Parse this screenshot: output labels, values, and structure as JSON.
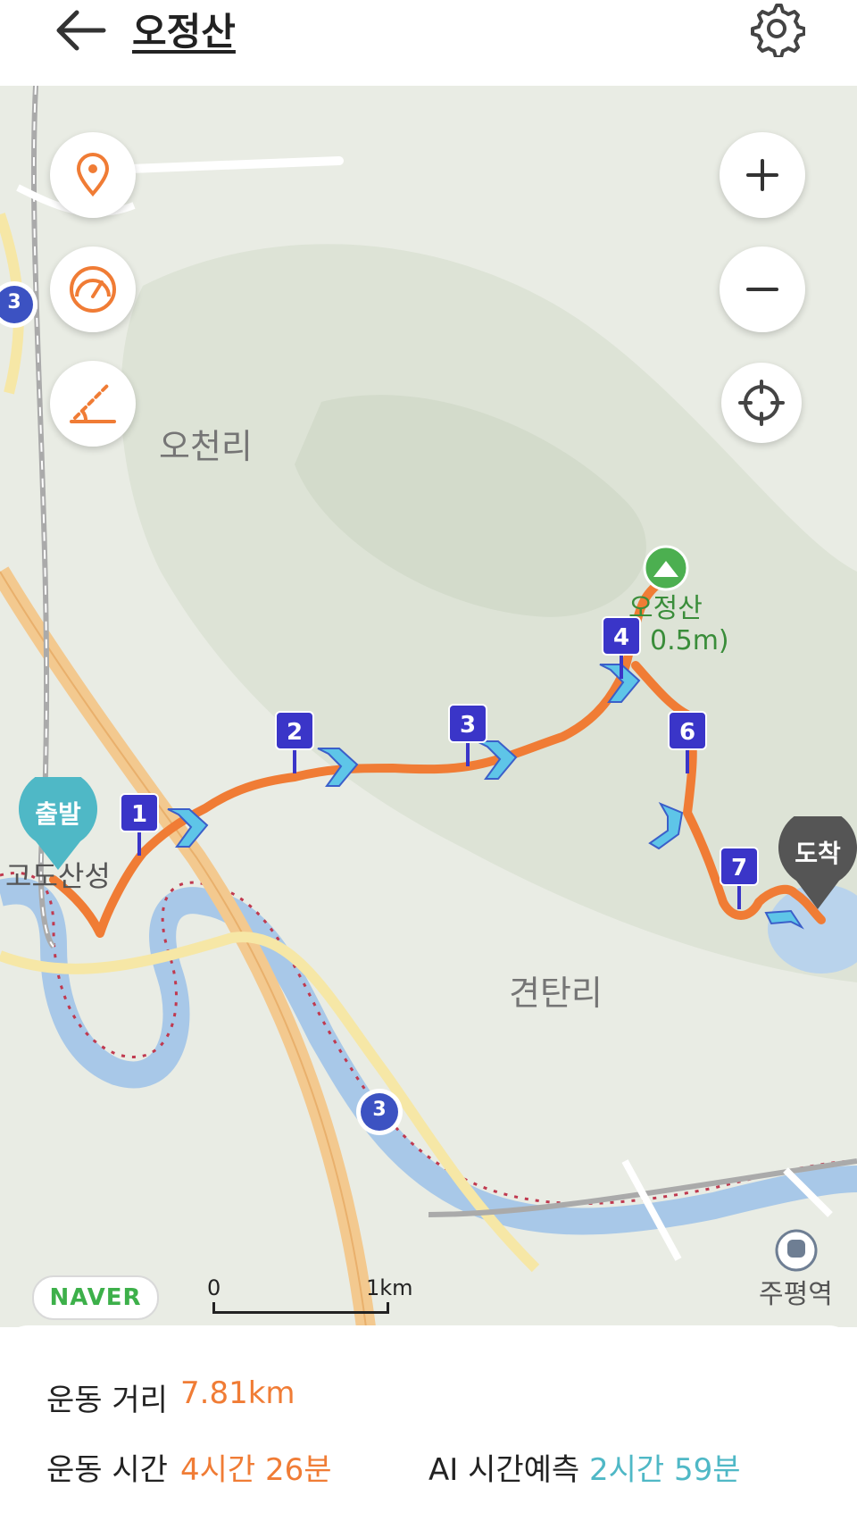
{
  "header": {
    "title": "오정산"
  },
  "map": {
    "places": [
      "오천리",
      "견탄리",
      "주평역",
      "고도산성"
    ],
    "peak": {
      "name_part": "오정산",
      "elevation_text": "0.5m)"
    },
    "start_label": "출발",
    "end_label": "도착",
    "waypoints": [
      "1",
      "2",
      "3",
      "4",
      "6",
      "7"
    ],
    "road_shields": [
      "3",
      "3"
    ],
    "naver_logo": "NAVER",
    "scale": {
      "start": "0",
      "end": "1km"
    }
  },
  "stats": {
    "distance_label": "운동 거리",
    "distance_value": "7.81km",
    "time_label": "운동 시간",
    "time_value": "4시간 26분",
    "ai_label": "AI 시간예측",
    "ai_value": "2시간 59분"
  },
  "colors": {
    "route": "#f07c35",
    "accent_orange": "#f07c35",
    "accent_teal": "#4fb8c6",
    "marker": "#3a35c8"
  },
  "icons": [
    "back-arrow-icon",
    "gear-icon",
    "location-pin-icon",
    "speedometer-icon",
    "slope-icon",
    "plus-icon",
    "minus-icon",
    "crosshair-icon"
  ]
}
